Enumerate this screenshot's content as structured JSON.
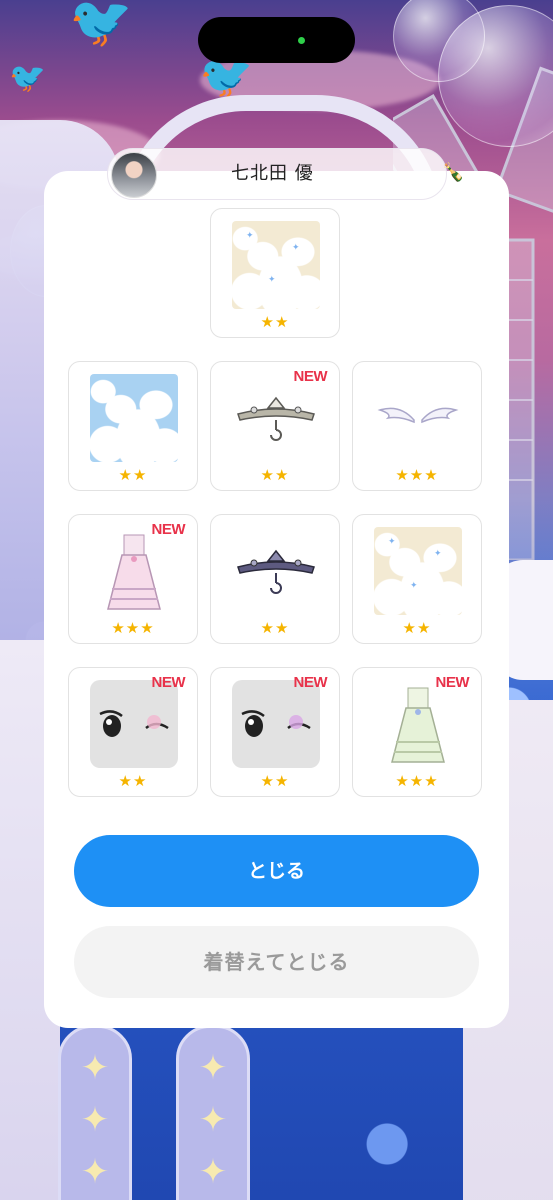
{
  "profile": {
    "name": "七北田 優",
    "emoji": "🍾"
  },
  "items": [
    {
      "id": "bg-cream-clouds-1",
      "stars": "★★",
      "new": ""
    },
    {
      "id": "bg-blue-clouds",
      "stars": "★★",
      "new": ""
    },
    {
      "id": "tiara-silver",
      "stars": "★★",
      "new": "NEW"
    },
    {
      "id": "angel-wings",
      "stars": "★★★",
      "new": ""
    },
    {
      "id": "pink-dress",
      "stars": "★★★",
      "new": "NEW"
    },
    {
      "id": "tiara-dark",
      "stars": "★★",
      "new": ""
    },
    {
      "id": "bg-cream-clouds-2",
      "stars": "★★",
      "new": ""
    },
    {
      "id": "eyes-pink-1",
      "stars": "★★",
      "new": "NEW"
    },
    {
      "id": "eyes-pink-2",
      "stars": "★★",
      "new": "NEW"
    },
    {
      "id": "mint-dress",
      "stars": "★★★",
      "new": "NEW"
    }
  ],
  "buttons": {
    "close": "とじる",
    "change_and_close": "着替えてとじる"
  },
  "colors": {
    "primary": "#1e90f5",
    "new_badge": "#e8324a",
    "star": "#f5b400"
  }
}
